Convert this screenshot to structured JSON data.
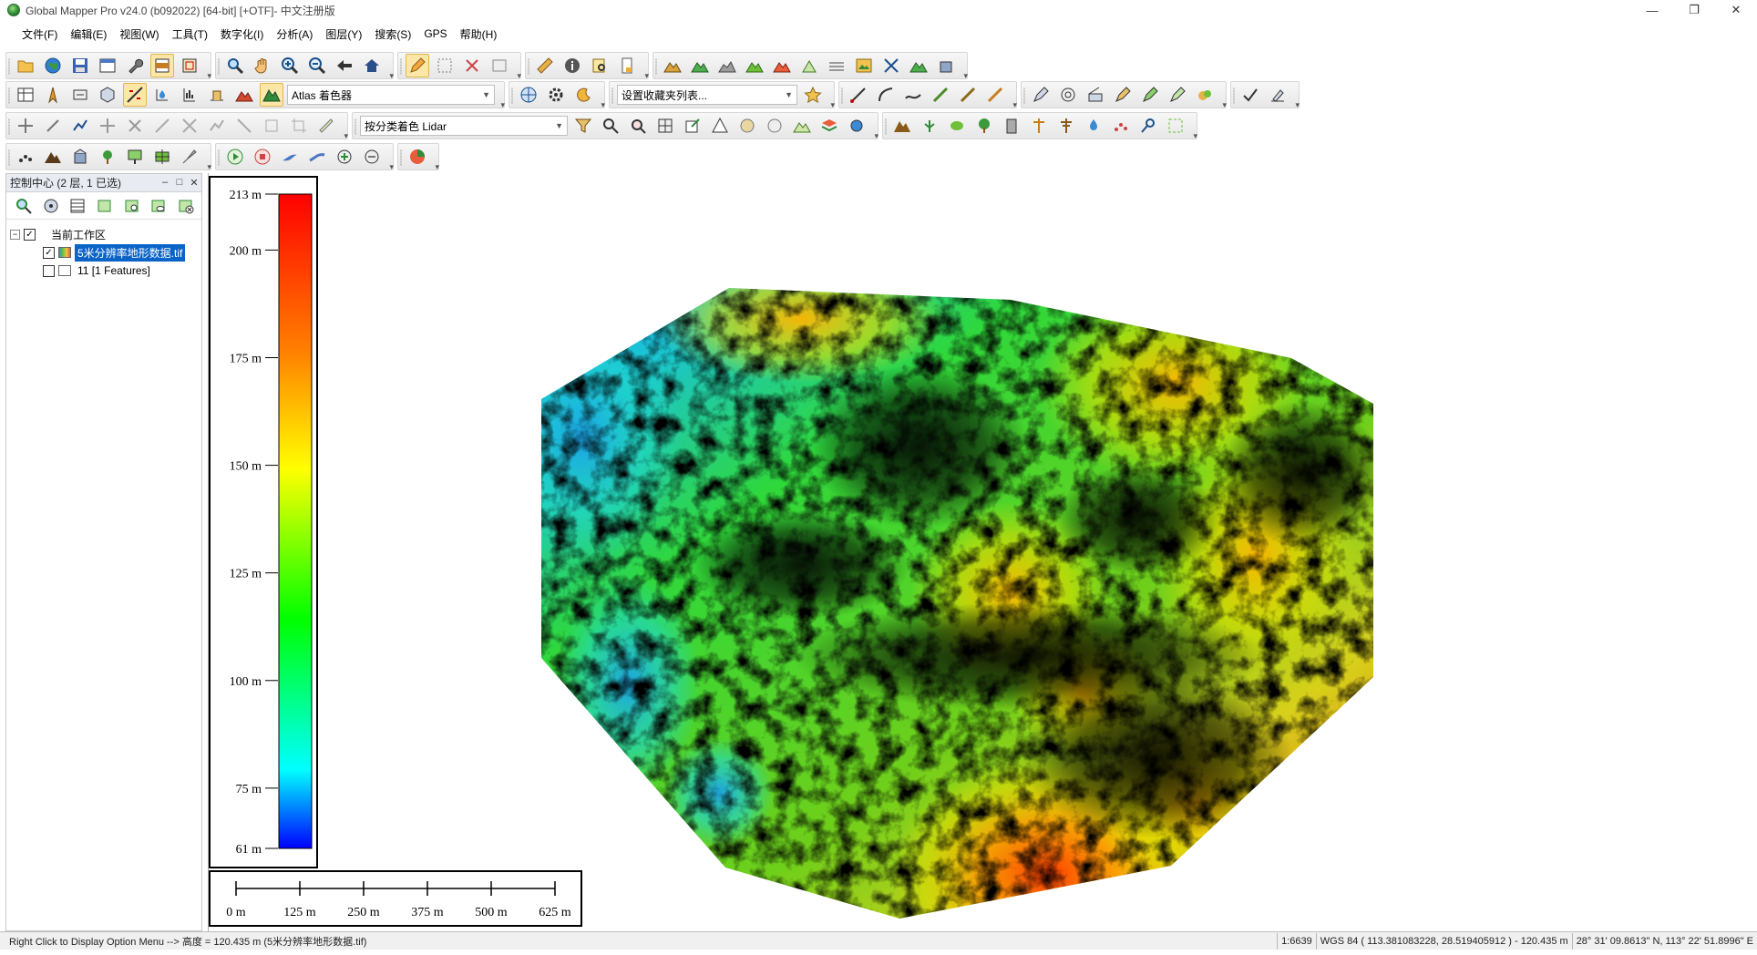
{
  "window": {
    "title": "Global Mapper Pro v24.0 (b092022) [64-bit] [+OTF]- 中文注册版",
    "minimize": "—",
    "restore": "❐",
    "close": "✕"
  },
  "menu": [
    {
      "label": "文件(F)"
    },
    {
      "label": "编辑(E)"
    },
    {
      "label": "视图(W)"
    },
    {
      "label": "工具(T)"
    },
    {
      "label": "数字化(I)"
    },
    {
      "label": "分析(A)"
    },
    {
      "label": "图层(Y)"
    },
    {
      "label": "搜索(S)"
    },
    {
      "label": "GPS"
    },
    {
      "label": "帮助(H)"
    }
  ],
  "toolbars": {
    "row2_combo_atlas": "Atlas 着色器",
    "row2_combo_favorites": "设置收藏夹列表...",
    "row3_combo_lidar": "按分类着色 Lidar"
  },
  "control_center": {
    "title": "控制中心 (2 层, 1 已选)",
    "workspace_label": "当前工作区",
    "layers": [
      {
        "label": "5米分辨率地形数据.tif",
        "checked": true,
        "selected": true
      },
      {
        "label": "11 [1 Features]",
        "checked": false,
        "selected": false
      }
    ]
  },
  "legend": {
    "labels": [
      "213 m",
      "200 m",
      "175 m",
      "150 m",
      "125 m",
      "100 m",
      "75 m",
      "61 m"
    ],
    "values": [
      213,
      200,
      175,
      150,
      125,
      100,
      75,
      61
    ],
    "min": 61,
    "max": 213,
    "colors": [
      "#ff0000",
      "#ff8000",
      "#ffff00",
      "#00ff00",
      "#00ffff",
      "#0000ff"
    ]
  },
  "scalebar": {
    "labels": [
      "0 m",
      "125 m",
      "250 m",
      "375 m",
      "500 m",
      "625 m"
    ],
    "values": [
      0,
      125,
      250,
      375,
      500,
      625
    ]
  },
  "status": {
    "hint": "Right Click to Display Option Menu --> 高度 = 120.435 m (5米分辨率地形数据.tif)",
    "scale": "1:6639",
    "coords": "WGS 84 ( 113.381083228, 28.519405912 ) - 120.435 m",
    "dms": "28° 31' 09.8613\" N, 113° 22' 51.8996\" E"
  }
}
